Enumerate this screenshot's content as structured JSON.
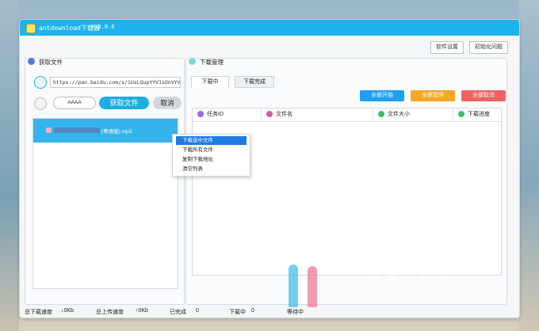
{
  "window": {
    "title": "antdownload下载器",
    "version": "V:3.0.6"
  },
  "top_buttons": {
    "settings": "软件设置",
    "init_issue": "初始化问题"
  },
  "left_panel": {
    "title": "获取文件",
    "url_value": "https://pan.baidu.com/s/1UsLQupYYV1sOnVYVV2ZnCd",
    "code_value": "AAAA",
    "fetch_button": "获取文件",
    "cancel_button": "取消",
    "file_item_suffix": "(粤语版).mp3"
  },
  "context_menu": {
    "items": [
      "下载选中文件",
      "下载所有文件",
      "复制下载地址",
      "清空列表"
    ]
  },
  "right_panel": {
    "title": "下载管理",
    "tabs": [
      "下载中",
      "下载完成"
    ],
    "actions": {
      "start_all": "全部开始",
      "pause_all": "全部暂停",
      "cancel_all": "全部取消"
    },
    "columns": [
      "任务ID",
      "文件名",
      "文件大小",
      "下载进度"
    ]
  },
  "status_bar": {
    "total_download_speed_label": "总下载速度",
    "total_download_speed_value": "↓0Kb",
    "total_upload_speed_label": "总上传速度",
    "total_upload_speed_value": "↑0Kb",
    "completed_label": "已完成",
    "completed_value": "0",
    "downloading_label": "下载中",
    "downloading_value": "0",
    "waiting_label": "等待中"
  },
  "watermark": {
    "text": "当客学习网",
    "url": "www.zanqiuxi.com"
  },
  "colors": {
    "titlebar": "#1cb4ea",
    "selected_row": "#35b4ec",
    "start_all": "#1e9ff2",
    "pause_all": "#f5a623",
    "cancel_all": "#f06262"
  }
}
